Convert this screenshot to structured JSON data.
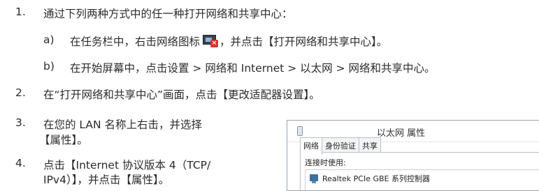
{
  "steps": [
    {
      "num": "1.",
      "text": "通过下列两种方式中的任一种打开网络和共享中心："
    },
    {
      "num": "2.",
      "text": "在“打开网络和共享中心”画面，点击【更改适配器设置】。"
    },
    {
      "num": "3.",
      "line1": "在您的 LAN 名称上右击，并选择",
      "line2": "【属性】。"
    },
    {
      "num": "4.",
      "line1": "点击【Internet 协议版本 4（TCP/",
      "line2": "IPv4）】，并点击【属性】。"
    }
  ],
  "sub_steps": [
    {
      "letter": "a)",
      "text_before": "在任务栏中，右击网络图标",
      "icon": "network-error-icon",
      "text_after": "，并点击【打开网络和共享中心】。"
    },
    {
      "letter": "b)",
      "text": "在开始屏幕中，点击设置 > 网络和 Internet > 以太网 > 网络和共享中心。"
    }
  ],
  "dialog": {
    "title": "以太网 属性",
    "tabs": [
      "网络",
      "身份验证",
      "共享"
    ],
    "active_tab": "网络",
    "connect_using_label": "连接时使用:",
    "adapter_name": "Realtek PCIe GBE 系列控制器"
  }
}
